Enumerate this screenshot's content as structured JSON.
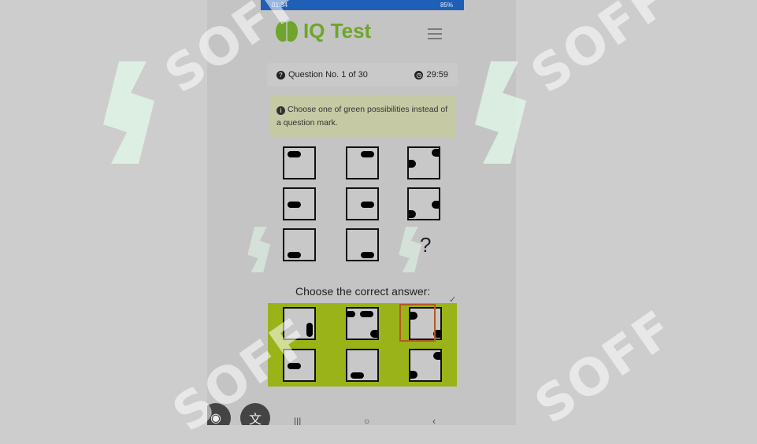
{
  "status_bar": {
    "time": "01:34",
    "battery": "85%"
  },
  "header": {
    "app_title": "IQ Test",
    "logo_icon": "brain-icon",
    "menu_icon": "hamburger-menu-icon"
  },
  "question_bar": {
    "question_label": "Question No. 1 of 30",
    "timer": "29:59"
  },
  "instructions": {
    "text": "Choose one of green possibilities instead of a question mark."
  },
  "puzzle": {
    "missing_symbol": "?"
  },
  "answers": {
    "title": "Choose the correct answer:",
    "selected_index": 2
  },
  "watermark": {
    "text": "SOFF"
  },
  "colors": {
    "brand_green": "#6fa52a",
    "answer_bg": "#99b319",
    "status_blue": "#1f5fb6",
    "selection": "#b35a22"
  }
}
